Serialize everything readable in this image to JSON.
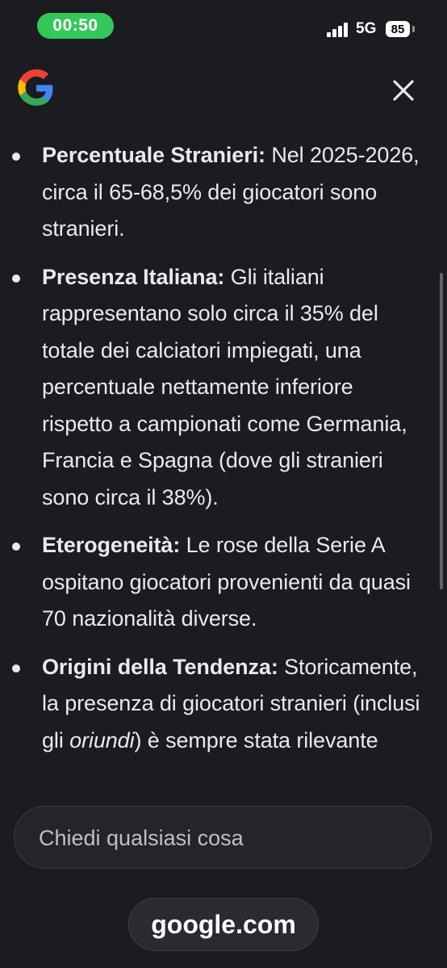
{
  "status_bar": {
    "time": "00:50",
    "network": "5G",
    "battery": "85",
    "colors": {
      "time_pill": "#34c759"
    }
  },
  "header": {
    "logo_icon": "google-g-icon",
    "close_icon": "close-icon"
  },
  "content": {
    "bullets": [
      {
        "heading": "Percentuale Stranieri:",
        "text": " Nel 2025-2026, circa il 65-68,5% dei giocatori sono stranieri."
      },
      {
        "heading": "Presenza Italiana:",
        "text": " Gli italiani rappresentano solo circa il 35% del totale dei calciatori impiegati, una percentuale nettamente inferiore rispetto a campionati come Germania, Francia e Spagna (dove gli stranieri sono circa il 38%)."
      },
      {
        "heading": "Eterogeneità:",
        "text": " Le rose della Serie A ospitano giocatori provenienti da quasi 70 nazionalità diverse."
      },
      {
        "heading": "Origini della Tendenza:",
        "text": " Storicamente, la presenza di giocatori stranieri (inclusi gli ",
        "italic": "oriundi",
        "text2": ") è sempre stata rilevante"
      }
    ]
  },
  "search": {
    "placeholder": "Chiedi qualsiasi cosa"
  },
  "footer": {
    "url": "google.com"
  }
}
